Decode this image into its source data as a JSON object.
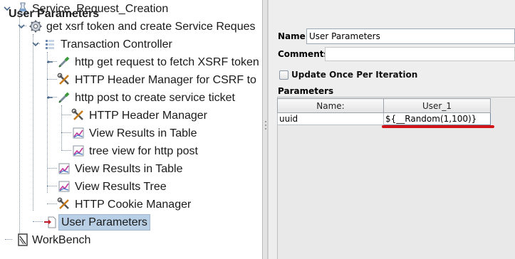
{
  "tree": {
    "nodes": [
      {
        "label": "Service_Request_Creation",
        "icon": "test-plan-flask-icon"
      },
      {
        "label": "get xsrf token and create Service Reques",
        "icon": "thread-group-gear-icon"
      },
      {
        "label": "Transaction Controller",
        "icon": "transaction-controller-icon"
      },
      {
        "label": "http get request to fetch XSRF token",
        "icon": "http-sampler-pipette-icon"
      },
      {
        "label": "HTTP Header Manager for CSRF to",
        "icon": "header-manager-tools-icon"
      },
      {
        "label": "http post to create service ticket",
        "icon": "http-sampler-pipette-icon"
      },
      {
        "label": "HTTP Header Manager",
        "icon": "header-manager-tools-icon"
      },
      {
        "label": "View Results in Table",
        "icon": "listener-graph-icon"
      },
      {
        "label": "tree view for http post",
        "icon": "listener-graph-icon"
      },
      {
        "label": "View Results in Table",
        "icon": "listener-graph-icon"
      },
      {
        "label": "View Results Tree",
        "icon": "listener-graph-icon"
      },
      {
        "label": "HTTP Cookie Manager",
        "icon": "cookie-manager-tools-icon"
      },
      {
        "label": "User Parameters",
        "icon": "user-parameters-icon"
      },
      {
        "label": "WorkBench",
        "icon": "workbench-icon"
      }
    ],
    "selected": "User Parameters"
  },
  "panel": {
    "title": "User Parameters",
    "name_label": "Name:",
    "name_value": "User Parameters",
    "comments_label": "Comments:",
    "comments_value": "",
    "checkbox_label": "Update Once Per Iteration",
    "checkbox_checked": false,
    "params_label": "Parameters",
    "table": {
      "headers": [
        "Name:",
        "User_1"
      ],
      "rows": [
        [
          "uuid",
          "${__Random(1,100)}"
        ]
      ]
    },
    "highlight_color": "#d21419"
  }
}
